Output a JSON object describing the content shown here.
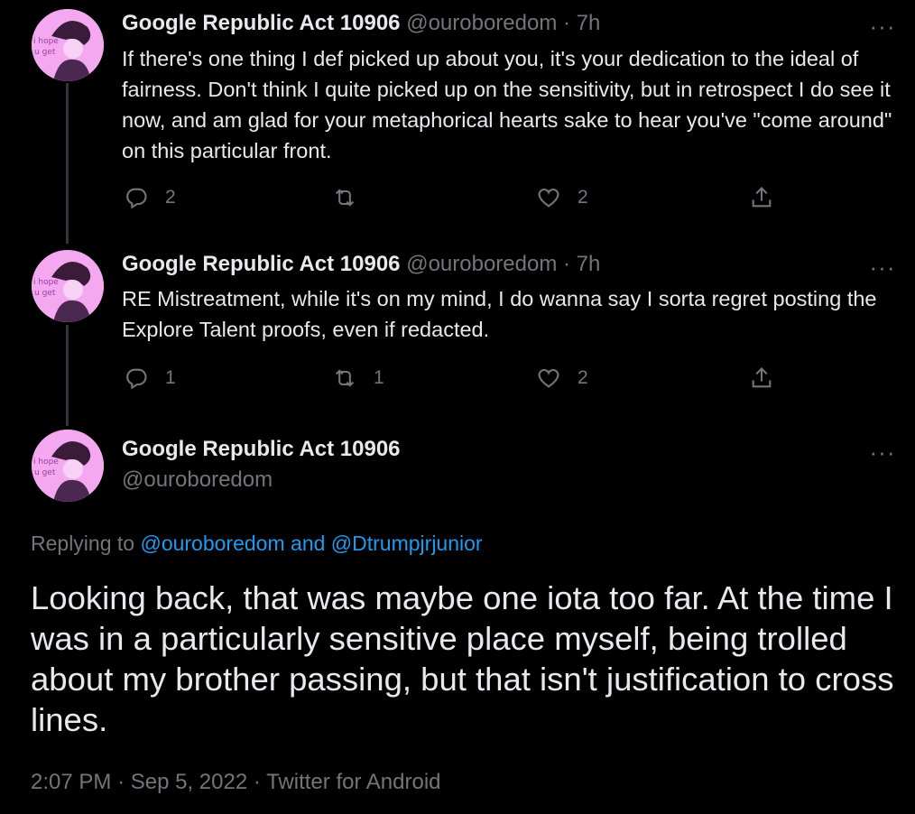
{
  "tweets": [
    {
      "name": "Google Republic Act 10906",
      "handle": "@ouroboredom",
      "time": "7h",
      "text": "If there's one thing I def picked up about you, it's your dedication to the ideal of fairness. Don't think I quite picked up on the sensitivity, but in retrospect I do see it now, and am glad for your metaphorical hearts sake to hear you've \"come around\" on this particular front.",
      "replies": "2",
      "retweets": "",
      "likes": "2"
    },
    {
      "name": "Google Republic Act 10906",
      "handle": "@ouroboredom",
      "time": "7h",
      "text": "RE Mistreatment, while it's on my mind, I do wanna say I sorta regret posting the Explore Talent proofs, even if redacted.",
      "replies": "1",
      "retweets": "1",
      "likes": "2"
    }
  ],
  "main_tweet": {
    "name": "Google Republic Act 10906",
    "handle": "@ouroboredom",
    "replying_prefix": "Replying to",
    "reply_mention_1": "@ouroboredom",
    "reply_and": "and",
    "reply_mention_2": "@Dtrumpjrjunior",
    "text": "Looking back, that was maybe one iota too far. At the time I was in a particularly sensitive place myself, being trolled about my brother passing, but that isn't justification to cross lines.",
    "time": "2:07 PM",
    "date": "Sep 5, 2022",
    "source": "Twitter for Android"
  },
  "separator": "·",
  "more_glyph": "···",
  "avatar_text": [
    "i hope",
    "u get"
  ],
  "colors": {
    "background": "#000000",
    "text": "#e7e9ea",
    "muted": "#71767b",
    "link": "#1d9bf0",
    "avatar_bg": "#f3a8f0"
  },
  "icons": [
    "reply-icon",
    "retweet-icon",
    "like-icon",
    "share-icon",
    "more-icon"
  ]
}
